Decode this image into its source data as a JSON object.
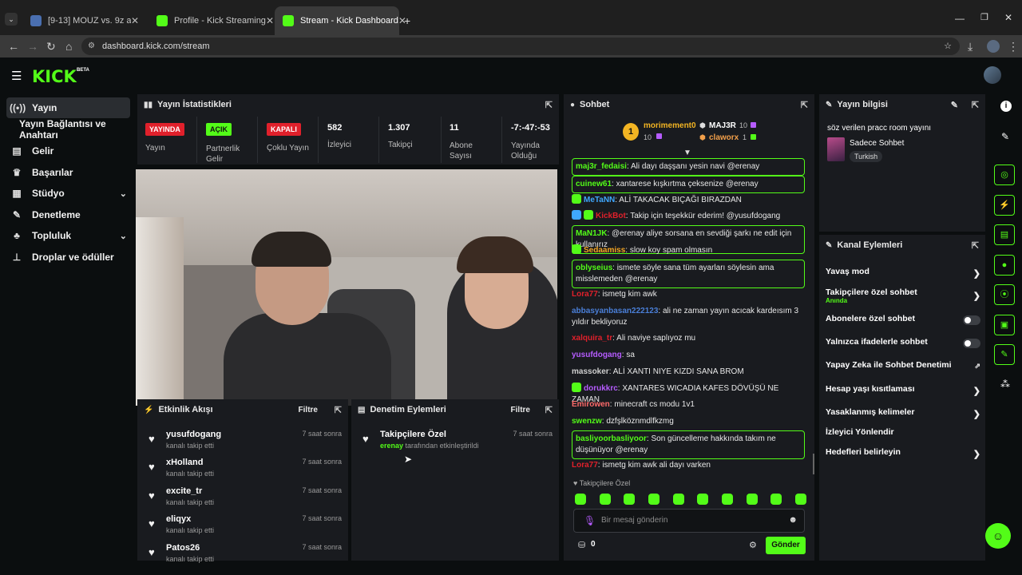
{
  "browser": {
    "tabs": [
      {
        "title": "[9-13] MOUZ vs. 9z at BLAST O",
        "active": false
      },
      {
        "title": "Profile - Kick Streaming",
        "active": false
      },
      {
        "title": "Stream - Kick Dashboard",
        "active": true
      }
    ],
    "url": "dashboard.kick.com/stream"
  },
  "app": {
    "logo": "KICK",
    "beta": "BETA",
    "accent": "#53fc18"
  },
  "sidebar": {
    "items": [
      {
        "label": "Yayın",
        "icon": "broadcast-icon"
      },
      {
        "label": "Yayın Bağlantısı ve Anahtarı",
        "icon": ""
      },
      {
        "label": "Gelir",
        "icon": "revenue-icon"
      },
      {
        "label": "Başarılar",
        "icon": "trophy-icon"
      },
      {
        "label": "Stüdyo",
        "icon": "studio-icon"
      },
      {
        "label": "Denetleme",
        "icon": "wrench-icon"
      },
      {
        "label": "Topluluk",
        "icon": "community-icon"
      },
      {
        "label": "Droplar ve ödüller",
        "icon": "drops-icon"
      }
    ]
  },
  "stats": {
    "title": "Yayın İstatistikleri",
    "items": [
      {
        "badge": "YAYINDA",
        "label": "Yayın"
      },
      {
        "badge": "AÇIK",
        "label": "Partnerlik Gelir"
      },
      {
        "badge": "KAPALI",
        "label": "Çoklu Yayın"
      },
      {
        "value": "582",
        "label": "İzleyici"
      },
      {
        "value": "1.307",
        "label": "Takipçi"
      },
      {
        "value": "11",
        "label": "Abone Sayısı"
      },
      {
        "value": "-7:-47:-53",
        "label": "Yayında Olduğu"
      }
    ]
  },
  "activity": {
    "title": "Etkinlik Akışı",
    "filter": "Filtre",
    "items": [
      {
        "name": "yusufdogang",
        "sub": "kanalı takip etti",
        "time": "7 saat sonra"
      },
      {
        "name": "xHolland",
        "sub": "kanalı takip etti",
        "time": "7 saat sonra"
      },
      {
        "name": "excite_tr",
        "sub": "kanalı takip etti",
        "time": "7 saat sonra"
      },
      {
        "name": "eliqyx",
        "sub": "kanalı takip etti",
        "time": "7 saat sonra"
      },
      {
        "name": "Patos26",
        "sub": "kanalı takip etti",
        "time": "7 saat sonra"
      }
    ]
  },
  "moderation": {
    "title": "Denetim Eylemleri",
    "filter": "Filtre",
    "item": {
      "name": "Takipçilere Özel",
      "by": "erenay",
      "sub": "tarafından etkinleştirildi",
      "time": "7 saat sonra"
    }
  },
  "chat": {
    "title": "Sohbet",
    "leaders": [
      {
        "name": "morimement0",
        "count": "10",
        "rank": "1"
      },
      {
        "name": "MAJ3R",
        "count": "10"
      },
      {
        "name": "claworx",
        "count": "1"
      }
    ],
    "messages": [
      {
        "user": "maj3r_fedaisi",
        "text": "Ali dayı daşşanı yesin navi @erenay",
        "color": "#53fc18",
        "hl": true
      },
      {
        "user": "cuinew61",
        "text": "xantarese kışkırtma çeksenize @erenay",
        "color": "#53fc18",
        "hl": true
      },
      {
        "user": "MeTaNN",
        "text": "ALİ TAKACAK BIÇAĞI BIRAZDAN",
        "color": "#3fa8ff",
        "hl": false
      },
      {
        "user": "KickBot",
        "text": "Takip için teşekkür ederim! @yusufdogang",
        "color": "#e0202b",
        "hl": false
      },
      {
        "user": "MaN1JK",
        "text": "@erenay aliye sorsana en sevdiği şarkı ne edit için kullanırız",
        "color": "#53fc18",
        "hl": true
      },
      {
        "user": "Sedaamiss",
        "text": "slow koy spam olmasın",
        "color": "#f5a623",
        "hl": false
      },
      {
        "user": "oblyseius",
        "text": "ismete söyle sana tüm ayarları söylesin ama misslemeden @erenay",
        "color": "#53fc18",
        "hl": true
      },
      {
        "user": "Lora77",
        "text": "ismetg kim awk",
        "color": "#e0202b",
        "hl": false
      },
      {
        "user": "abbasyanbasan222123",
        "text": "ali ne zaman yayın acıcak kardeısım 3 yıldır bekliyoruz",
        "color": "#4a7fd8",
        "hl": false
      },
      {
        "user": "xalquira_tr",
        "text": "Ali naviye saplıyoz mu",
        "color": "#e0202b",
        "hl": false
      },
      {
        "user": "yusufdogang",
        "text": "sa",
        "color": "#b65cff",
        "hl": false
      },
      {
        "user": "massoker",
        "text": "ALİ XANTI NIYE KIZDI SANA BROM",
        "color": "#cfcfcf",
        "hl": false
      },
      {
        "user": "dorukkrc",
        "text": "XANTARES WICADIA KAFES DÖVÜŞÜ NE ZAMAN",
        "color": "#b65cff",
        "hl": false
      },
      {
        "user": "Emirowen",
        "text": "minecraft cs modu 1v1",
        "color": "#ff6b6b",
        "hl": false
      },
      {
        "user": "swenzw",
        "text": "dzfşlköznmdlfkzmg",
        "color": "#53fc18",
        "hl": false
      },
      {
        "user": "basliyoorbasliyoor",
        "text": "Son güncelleme hakkında takım ne düşünüyor @erenay",
        "color": "#53fc18",
        "hl": true
      },
      {
        "user": "Lora77",
        "text": "ismetg kim awk ali dayı varken",
        "color": "#e0202b",
        "hl": false
      }
    ],
    "mode_label": "Takipçilere Özel",
    "input_placeholder": "Bir mesaj gönderin",
    "points": "0",
    "send": "Gönder"
  },
  "streaminfo": {
    "title": "Yayın bilgisi",
    "stream_title": "söz verilen pracc room yayını",
    "category": "Sadece Sohbet",
    "language": "Turkish"
  },
  "channel_actions": {
    "title": "Kanal Eylemleri",
    "items": [
      {
        "label": "Yavaş mod",
        "control": "chevron",
        "sub": ""
      },
      {
        "label": "Takipçilere özel sohbet",
        "control": "chevron",
        "sub": "Anında"
      },
      {
        "label": "Abonelere özel sohbet",
        "control": "toggle",
        "sub": ""
      },
      {
        "label": "Yalnızca ifadelerle sohbet",
        "control": "toggle",
        "sub": ""
      },
      {
        "label": "Yapay Zeka ile Sohbet Denetimi",
        "control": "external",
        "sub": ""
      },
      {
        "label": "Hesap yaşı kısıtlaması",
        "control": "chevron",
        "sub": ""
      },
      {
        "label": "Yasaklanmış kelimeler",
        "control": "chevron",
        "sub": ""
      },
      {
        "label": "İzleyici Yönlendir",
        "control": "none",
        "sub": ""
      },
      {
        "label": "Hedefleri belirleyin",
        "control": "chevron",
        "sub": ""
      }
    ]
  }
}
